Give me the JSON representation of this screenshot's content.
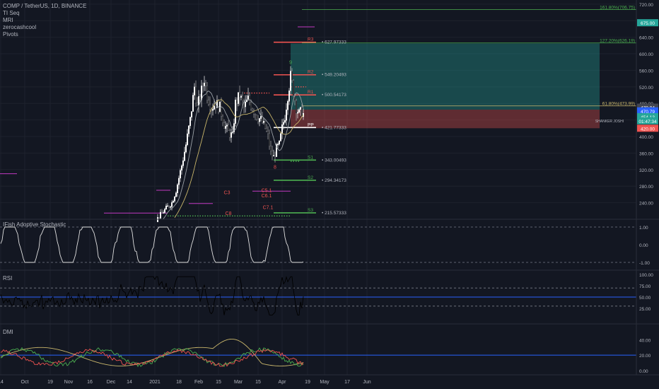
{
  "header": {
    "symbol_line": "COMP / TetherUS, 1D, BINANCE",
    "indicators": [
      "TI Seq",
      "MRI",
      "zerocashcool",
      "Pivots"
    ]
  },
  "panes": {
    "stoch_title": "IFish Adoptive Stochastic",
    "rsi_title": "RSI",
    "dmi_title": "DMI"
  },
  "colors": {
    "background": "#131722",
    "grid": "#1e222d",
    "text": "#b2b5be",
    "bull": "#ffffff",
    "bear": "#000000",
    "ma": "#c9b66b",
    "green": "#4caf50",
    "red": "#ef5350",
    "magenta": "#c039c0",
    "blue": "#2962ff",
    "teal_zone": "#26a69a",
    "red_zone": "#ef5350"
  },
  "chart_data": [
    {
      "type": "candlestick",
      "pane": "price",
      "x_ticks": [
        "14",
        "Oct",
        "19",
        "Nov",
        "16",
        "Dec",
        "14",
        "2021",
        "18",
        "Feb",
        "15",
        "Mar",
        "15",
        "Apr",
        "19",
        "May",
        "17",
        "Jun"
      ],
      "y_ticks": [
        240,
        280,
        320,
        360,
        400,
        440,
        480,
        520,
        560,
        600,
        640,
        680,
        720
      ],
      "y_tick_labels": [
        "240.00",
        "280.00",
        "320.00",
        "360.00",
        "400.00",
        "440.00",
        "480.00",
        "520.00",
        "560.00",
        "600.00",
        "640.00",
        "680.00",
        "720.00"
      ],
      "ylim": [
        200,
        730
      ],
      "price_labels": [
        {
          "text": "675.00",
          "value": 675,
          "color": "#26a69a"
        },
        {
          "text": "470.94",
          "value": 471,
          "color": "#434651"
        },
        {
          "text": "470.79",
          "value": 462,
          "color": "#2962ff"
        },
        {
          "text": "454.13",
          "value": 448,
          "color": "#26a69a"
        },
        {
          "text": "01:47:34",
          "value": 438,
          "color": "#26a69a"
        },
        {
          "text": "420.00",
          "value": 420,
          "color": "#ef5350"
        }
      ],
      "pivot_levels": [
        {
          "name": "R3",
          "value": 627.97333,
          "label": "627.97333",
          "color": "#ef5350"
        },
        {
          "name": "R2",
          "value": 549.20493,
          "label": "549.20493",
          "color": "#ef5350"
        },
        {
          "name": "R1",
          "value": 500.54173,
          "label": "500.54173",
          "color": "#ef5350"
        },
        {
          "name": "PP",
          "value": 421.77333,
          "label": "421.77333",
          "color": "#ffffff"
        },
        {
          "name": "S1",
          "value": 343.00493,
          "label": "343.00493",
          "color": "#4caf50"
        },
        {
          "name": "S2",
          "value": 294.34173,
          "label": "294.34173",
          "color": "#4caf50"
        },
        {
          "name": "S3",
          "value": 215.57333,
          "label": "215.57333",
          "color": "#4caf50"
        }
      ],
      "fib_levels": [
        {
          "text": "161.80%(706.75)",
          "value": 706.75
        },
        {
          "text": "127.20%(626.19)",
          "value": 626.19
        },
        {
          "text": "61.80%(473.99)",
          "value": 473.99
        }
      ],
      "annotations": [
        {
          "text": "9",
          "value": 575,
          "color": "#4caf50"
        },
        {
          "text": "8",
          "value": 322,
          "color": "#ef5350"
        },
        {
          "text": "C3",
          "value": 261,
          "color": "#ef5350"
        },
        {
          "text": "C5.1",
          "value": 266,
          "color": "#ef5350"
        },
        {
          "text": "C6.1",
          "value": 253,
          "color": "#ef5350"
        },
        {
          "text": "C7.1",
          "value": 225,
          "color": "#ef5350"
        },
        {
          "text": "C8",
          "value": 210,
          "color": "#ef5350"
        },
        {
          "text": "SHANKER JOSHI",
          "value": 434,
          "color": "#b2b5be"
        }
      ],
      "candles_note": "Daily OHLC from mid-Sep 2020 to Apr 2021; only the portion from early Jan 2021 is within the visible price range."
    },
    {
      "type": "line",
      "pane": "stochastic",
      "title": "IFish Adoptive Stochastic",
      "y_ticks": [
        1.0,
        0.0,
        -1.0
      ],
      "y_tick_labels": [
        "1.00",
        "0.00",
        "-1.00"
      ],
      "ylim": [
        -1.2,
        1.2
      ]
    },
    {
      "type": "line",
      "pane": "rsi",
      "title": "RSI",
      "y_ticks": [
        100,
        75,
        50,
        25
      ],
      "y_tick_labels": [
        "100.00",
        "75.00",
        "50.00",
        "25.00"
      ],
      "ylim": [
        0,
        100
      ]
    },
    {
      "type": "line",
      "pane": "dmi",
      "title": "DMI",
      "y_ticks": [
        40,
        20,
        0
      ],
      "y_tick_labels": [
        "40.00",
        "20.00",
        "0.00"
      ],
      "ylim": [
        0,
        55
      ]
    }
  ]
}
